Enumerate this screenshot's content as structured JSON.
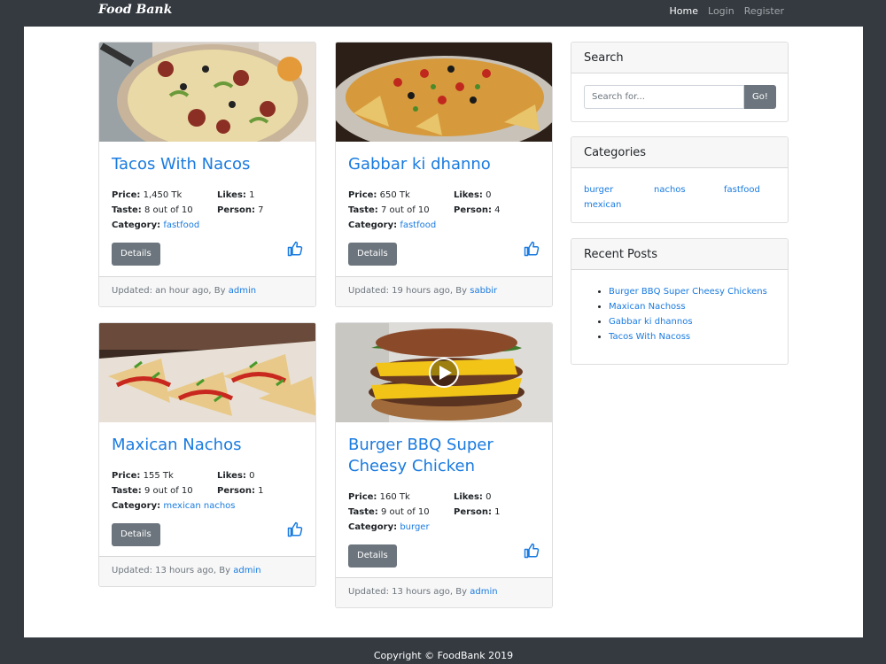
{
  "nav": {
    "brand": "Food Bank",
    "links": [
      {
        "label": "Home",
        "active": true
      },
      {
        "label": "Login",
        "active": false
      },
      {
        "label": "Register",
        "active": false
      }
    ]
  },
  "labels": {
    "price": "Price:",
    "likes": "Likes:",
    "taste": "Taste:",
    "person": "Person:",
    "category": "Category:",
    "details": "Details"
  },
  "posts": [
    {
      "title": "Tacos With Nacos",
      "price": "1,450 Tk",
      "likes": "1",
      "taste": "8 out of 10",
      "person": "7",
      "category": "fastfood",
      "updated": "Updated: an hour ago, By",
      "author": "admin",
      "image": "pizza-image"
    },
    {
      "title": "Gabbar ki dhanno",
      "price": "650 Tk",
      "likes": "0",
      "taste": "7 out of 10",
      "person": "4",
      "category": "fastfood",
      "updated": "Updated: 19 hours ago, By",
      "author": "sabbir",
      "image": "nachos-image"
    },
    {
      "title": "Maxican Nachos",
      "price": "155 Tk",
      "likes": "0",
      "taste": "9 out of 10",
      "person": "1",
      "category": "mexican nachos",
      "updated": "Updated: 13 hours ago, By",
      "author": "admin",
      "image": "nachos-plate-image"
    },
    {
      "title": "Burger BBQ Super Cheesy Chicken",
      "price": "160 Tk",
      "likes": "0",
      "taste": "9 out of 10",
      "person": "1",
      "category": "burger",
      "updated": "Updated: 13 hours ago, By",
      "author": "admin",
      "image": "burger-video-thumbnail"
    }
  ],
  "search": {
    "title": "Search",
    "placeholder": "Search for...",
    "button": "Go!"
  },
  "categories": {
    "title": "Categories",
    "items": [
      "burger",
      "nachos",
      "fastfood",
      "mexican"
    ]
  },
  "recent": {
    "title": "Recent Posts",
    "items": [
      "Burger BBQ Super Cheesy Chickens",
      "Maxican Nachoss",
      "Gabbar ki dhannos",
      "Tacos With Nacoss"
    ]
  },
  "footer": {
    "text": "Copyright © FoodBank 2019"
  },
  "colors": {
    "navbar": "#343a40",
    "link": "#1a7be0",
    "button": "#6c757d"
  }
}
